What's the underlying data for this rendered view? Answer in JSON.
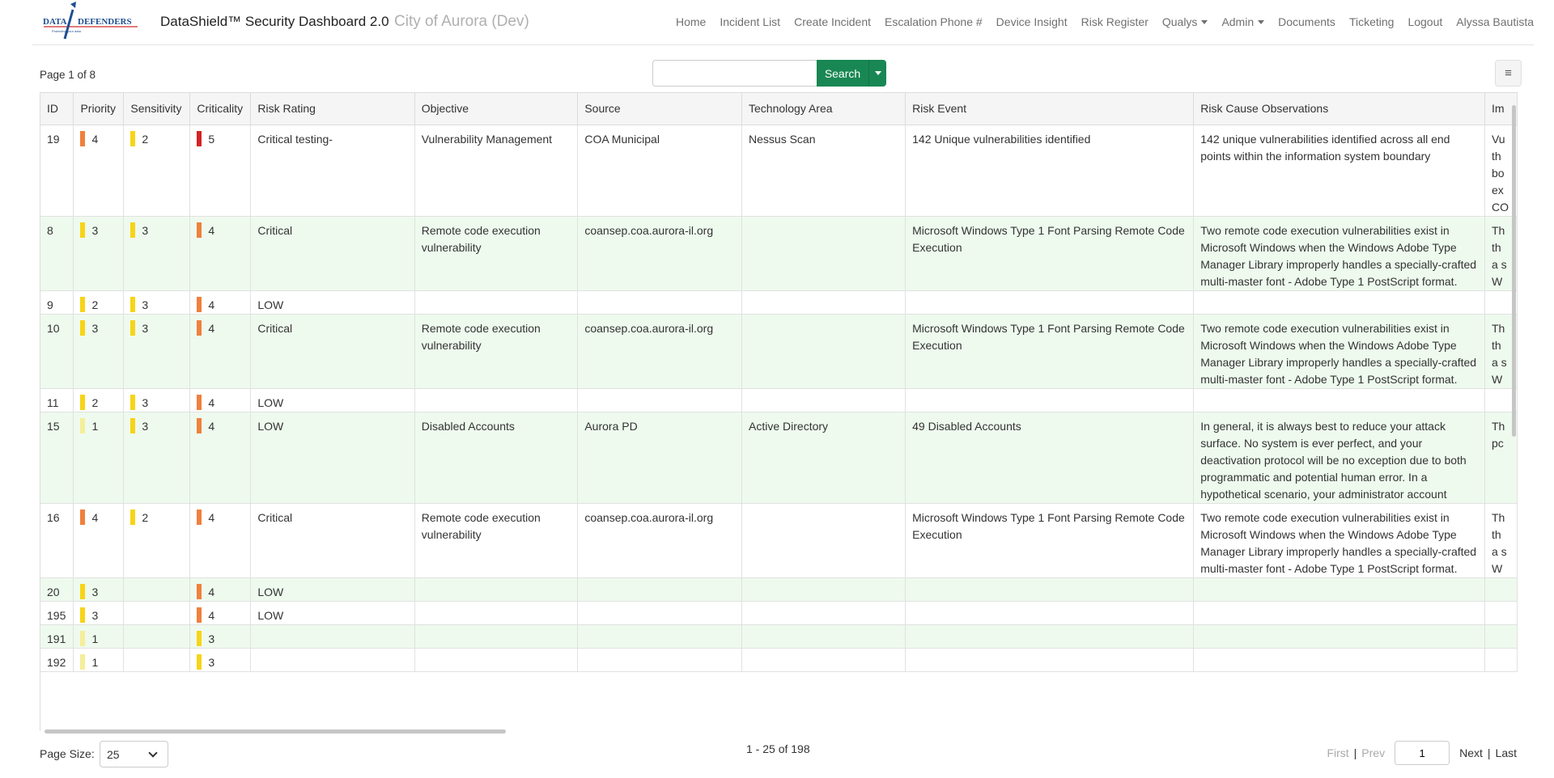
{
  "header": {
    "logo_text": "DATA DEFENDERS",
    "title": "DataShield™ Security Dashboard 2.0",
    "subtitle": "City of Aurora (Dev)",
    "nav": [
      "Home",
      "Incident List",
      "Create Incident",
      "Escalation Phone #",
      "Device Insight",
      "Risk Register"
    ],
    "dropdowns": [
      "Qualys",
      "Admin"
    ],
    "nav_right": [
      "Documents",
      "Ticketing",
      "Logout"
    ],
    "user": "Alyssa Bautista"
  },
  "toolbar": {
    "page_info": "Page 1 of 8",
    "search_value": "",
    "search_label": "Search",
    "menu_icon": "≡"
  },
  "colors": {
    "orange": "#f0803c",
    "yellow": "#f7d417",
    "pale_yellow": "#f5ee9a",
    "red": "#d32323",
    "row_alt": "#eefaee",
    "search_green": "#198754"
  },
  "table": {
    "columns": [
      "ID",
      "Priority",
      "Sensitivity",
      "Criticality",
      "Risk Rating",
      "Objective",
      "Source",
      "Technology Area",
      "Risk Event",
      "Risk Cause Observations",
      "Im"
    ],
    "rows": [
      {
        "id": "19",
        "priority": "4",
        "priority_color": "orange",
        "sensitivity": "2",
        "sensitivity_color": "yellow",
        "criticality": "5",
        "criticality_color": "red",
        "risk_rating": "Critical testing-",
        "objective": "Vulnerability Management",
        "source": "COA Municipal",
        "tech": "Nessus Scan",
        "event": "142 Unique vulnerabilities identified",
        "cause": "142 unique vulnerabilities identified across all end points within the information system boundary",
        "impact": "Vu th bo ex CO"
      },
      {
        "id": "8",
        "priority": "3",
        "priority_color": "yellow",
        "sensitivity": "3",
        "sensitivity_color": "yellow",
        "criticality": "4",
        "criticality_color": "orange",
        "risk_rating": "Critical",
        "objective": "Remote code execution vulnerability",
        "source": "coansep.coa.aurora-il.org",
        "tech": "",
        "event": "Microsoft Windows Type 1 Font Parsing Remote Code Execution",
        "cause": "Two remote code execution vulnerabilities exist in Microsoft Windows when the Windows Adobe Type Manager Library improperly handles a specially-crafted multi-master font - Adobe Type 1 PostScript format.",
        "impact": "Th th a s W"
      },
      {
        "id": "9",
        "priority": "2",
        "priority_color": "yellow",
        "sensitivity": "3",
        "sensitivity_color": "yellow",
        "criticality": "4",
        "criticality_color": "orange",
        "risk_rating": "LOW",
        "objective": "",
        "source": "",
        "tech": "",
        "event": "",
        "cause": "",
        "impact": ""
      },
      {
        "id": "10",
        "priority": "3",
        "priority_color": "yellow",
        "sensitivity": "3",
        "sensitivity_color": "yellow",
        "criticality": "4",
        "criticality_color": "orange",
        "risk_rating": "Critical",
        "objective": "Remote code execution vulnerability",
        "source": "coansep.coa.aurora-il.org",
        "tech": "",
        "event": "Microsoft Windows Type 1 Font Parsing Remote Code Execution",
        "cause": "Two remote code execution vulnerabilities exist in Microsoft Windows when the Windows Adobe Type Manager Library improperly handles a specially-crafted multi-master font - Adobe Type 1 PostScript format.",
        "impact": "Th th a s W"
      },
      {
        "id": "11",
        "priority": "2",
        "priority_color": "yellow",
        "sensitivity": "3",
        "sensitivity_color": "yellow",
        "criticality": "4",
        "criticality_color": "orange",
        "risk_rating": "LOW",
        "objective": "",
        "source": "",
        "tech": "",
        "event": "",
        "cause": "",
        "impact": ""
      },
      {
        "id": "15",
        "priority": "1",
        "priority_color": "pale_yellow",
        "sensitivity": "3",
        "sensitivity_color": "yellow",
        "criticality": "4",
        "criticality_color": "orange",
        "risk_rating": "LOW",
        "objective": "Disabled Accounts",
        "source": "Aurora PD",
        "tech": "Active Directory",
        "event": "49 Disabled Accounts",
        "cause": "In general, it is always best to reduce your attack surface. No system is ever perfect, and your deactivation protocol will be no exception due to both programmatic and potential human error. In a hypothetical scenario, your administrator account",
        "impact": "Th pc"
      },
      {
        "id": "16",
        "priority": "4",
        "priority_color": "orange",
        "sensitivity": "2",
        "sensitivity_color": "yellow",
        "criticality": "4",
        "criticality_color": "orange",
        "risk_rating": "Critical",
        "objective": "Remote code execution vulnerability",
        "source": "coansep.coa.aurora-il.org",
        "tech": "",
        "event": "Microsoft Windows Type 1 Font Parsing Remote Code Execution",
        "cause": "Two remote code execution vulnerabilities exist in Microsoft Windows when the Windows Adobe Type Manager Library improperly handles a specially-crafted multi-master font - Adobe Type 1 PostScript format.",
        "impact": "Th th a s W"
      },
      {
        "id": "20",
        "priority": "3",
        "priority_color": "yellow",
        "sensitivity": "",
        "sensitivity_color": "",
        "criticality": "4",
        "criticality_color": "orange",
        "risk_rating": "LOW",
        "objective": "",
        "source": "",
        "tech": "",
        "event": "",
        "cause": "",
        "impact": ""
      },
      {
        "id": "195",
        "priority": "3",
        "priority_color": "yellow",
        "sensitivity": "",
        "sensitivity_color": "",
        "criticality": "4",
        "criticality_color": "orange",
        "risk_rating": "LOW",
        "objective": "",
        "source": "",
        "tech": "",
        "event": "",
        "cause": "",
        "impact": ""
      },
      {
        "id": "191",
        "priority": "1",
        "priority_color": "pale_yellow",
        "sensitivity": "",
        "sensitivity_color": "",
        "criticality": "3",
        "criticality_color": "yellow",
        "risk_rating": "",
        "objective": "",
        "source": "",
        "tech": "",
        "event": "",
        "cause": "",
        "impact": ""
      },
      {
        "id": "192",
        "priority": "1",
        "priority_color": "pale_yellow",
        "sensitivity": "",
        "sensitivity_color": "",
        "criticality": "3",
        "criticality_color": "yellow",
        "risk_rating": "",
        "objective": "",
        "source": "",
        "tech": "",
        "event": "",
        "cause": "",
        "impact": ""
      }
    ]
  },
  "footer": {
    "page_size_label": "Page Size:",
    "page_size_value": "25",
    "range": "1 - 25 of 198",
    "first": "First",
    "prev": "Prev",
    "page_input": "1",
    "next": "Next",
    "last": "Last",
    "separator": "|"
  }
}
